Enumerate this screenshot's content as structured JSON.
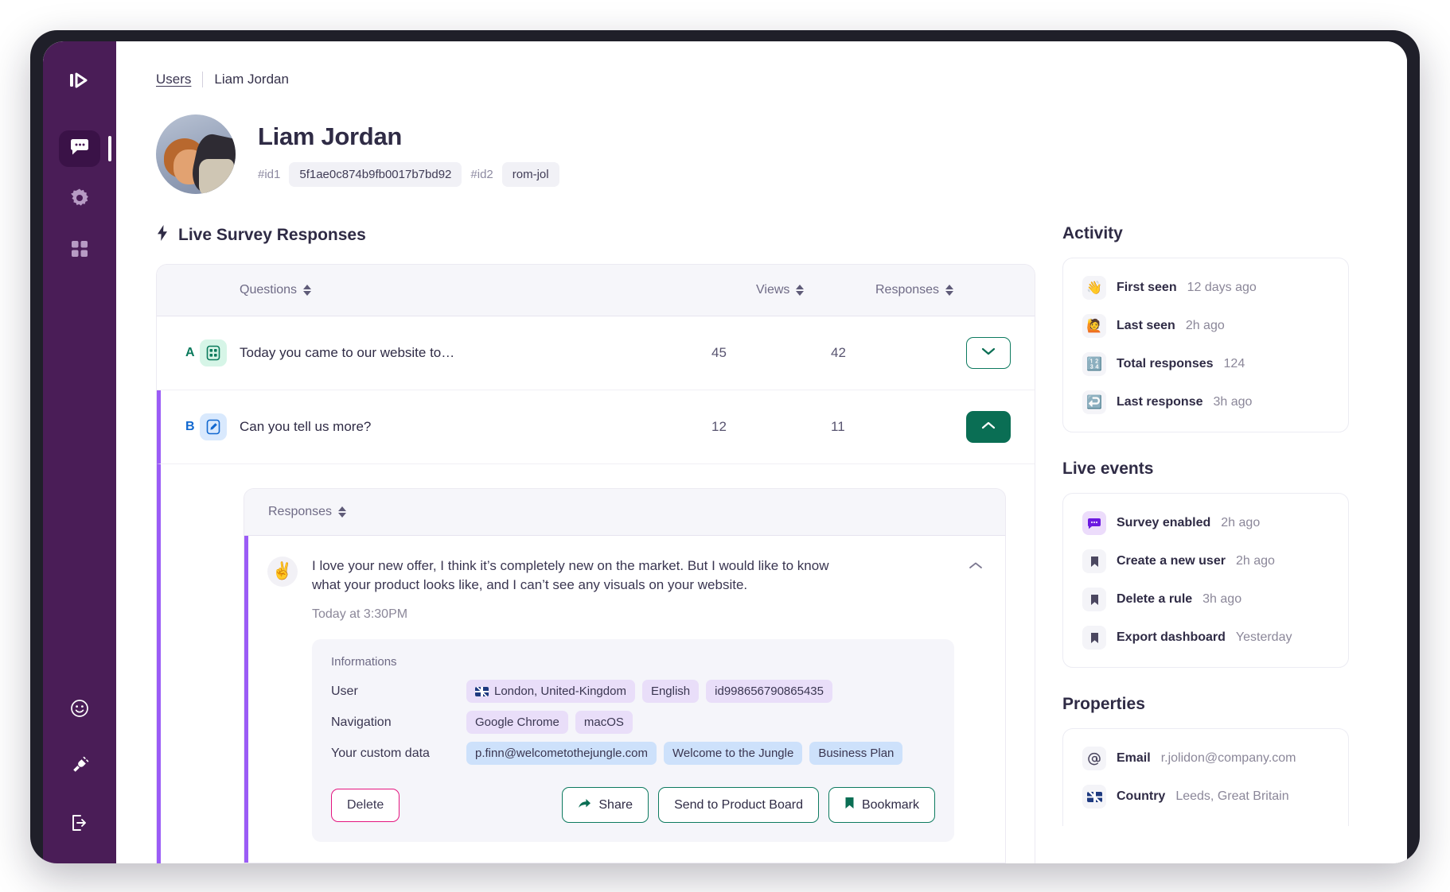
{
  "rail": {
    "logo": "logo-icon",
    "items": [
      {
        "name": "messages",
        "icon": "chat-bubble-icon",
        "active": true
      },
      {
        "name": "settings",
        "icon": "gear-icon",
        "active": false
      },
      {
        "name": "apps",
        "icon": "grid-icon",
        "active": false
      }
    ],
    "bottom": [
      {
        "name": "feedback",
        "icon": "smiley-icon"
      },
      {
        "name": "integrations",
        "icon": "plug-icon"
      },
      {
        "name": "logout",
        "icon": "logout-icon"
      }
    ]
  },
  "breadcrumb": {
    "root": "Users",
    "current": "Liam Jordan"
  },
  "profile": {
    "name": "Liam Jordan",
    "id1_label": "#id1",
    "id1_value": "5f1ae0c874b9fb0017b7bd92",
    "id2_label": "#id2",
    "id2_value": "rom-jol"
  },
  "survey": {
    "title": "Live Survey Responses",
    "title_icon": "bolt-icon",
    "columns": {
      "questions": "Questions",
      "views": "Views",
      "responses": "Responses"
    },
    "rows": [
      {
        "letter": "A",
        "icon": "multiple-choice-icon",
        "question": "Today you came to our website to…",
        "views": "45",
        "responses": "42",
        "expanded": false
      },
      {
        "letter": "B",
        "icon": "open-text-icon",
        "question": "Can you tell us more?",
        "views": "12",
        "responses": "11",
        "expanded": true
      }
    ]
  },
  "responses_panel": {
    "header": "Responses",
    "emoji": "✌️",
    "text": "I love your new offer, I think it’s completely new on the market. But I would like to know what your product looks like, and I can’t see any visuals on your website.",
    "time": "Today at 3:30PM",
    "informations": {
      "title": "Informations",
      "rows": [
        {
          "key": "User",
          "tags": [
            {
              "label": "London, United-Kingdom",
              "color": "purple",
              "flag": true
            },
            {
              "label": "English",
              "color": "purple",
              "flag": false
            },
            {
              "label": "id998656790865435",
              "color": "purple",
              "flag": false
            }
          ]
        },
        {
          "key": "Navigation",
          "tags": [
            {
              "label": "Google Chrome",
              "color": "purple",
              "flag": false
            },
            {
              "label": "macOS",
              "color": "purple",
              "flag": false
            }
          ]
        },
        {
          "key": "Your custom data",
          "tags": [
            {
              "label": "p.finn@welcometothejungle.com",
              "color": "blue",
              "flag": false
            },
            {
              "label": "Welcome to the Jungle",
              "color": "blue",
              "flag": false
            },
            {
              "label": "Business Plan",
              "color": "blue",
              "flag": false
            }
          ]
        }
      ]
    },
    "buttons": {
      "delete": "Delete",
      "share": "Share",
      "product_board": "Send to Product Board",
      "bookmark": "Bookmark"
    }
  },
  "activity": {
    "title": "Activity",
    "items": [
      {
        "emoji": "👋",
        "label": "First seen",
        "value": "12 days ago",
        "bg": "plain"
      },
      {
        "emoji": "🙋",
        "label": "Last seen",
        "value": "2h ago",
        "bg": "plain"
      },
      {
        "emoji": "🔢",
        "label": "Total responses",
        "value": "124",
        "bg": "plain"
      },
      {
        "emoji": "↩️",
        "label": "Last response",
        "value": "3h ago",
        "bg": "plain"
      }
    ]
  },
  "live_events": {
    "title": "Live events",
    "items": [
      {
        "icon": "chat-bubble-icon",
        "label": "Survey enabled",
        "value": "2h ago",
        "bg": "violet"
      },
      {
        "icon": "bookmark-icon",
        "label": "Create a new user",
        "value": "2h ago",
        "bg": "plain"
      },
      {
        "icon": "bookmark-icon",
        "label": "Delete a rule",
        "value": "3h ago",
        "bg": "plain"
      },
      {
        "icon": "bookmark-icon",
        "label": "Export dashboard",
        "value": "Yesterday",
        "bg": "plain"
      }
    ]
  },
  "properties": {
    "title": "Properties",
    "items": [
      {
        "icon": "at-icon",
        "label": "Email",
        "value": "r.jolidon@company.com"
      },
      {
        "icon": "flag-icon",
        "label": "Country",
        "value": "Leeds, Great Britain"
      }
    ]
  },
  "colors": {
    "rail": "#4a1d57",
    "accent_purple": "#9b5cf6",
    "accent_green": "#0a6e54",
    "accent_pink": "#e4157f"
  }
}
